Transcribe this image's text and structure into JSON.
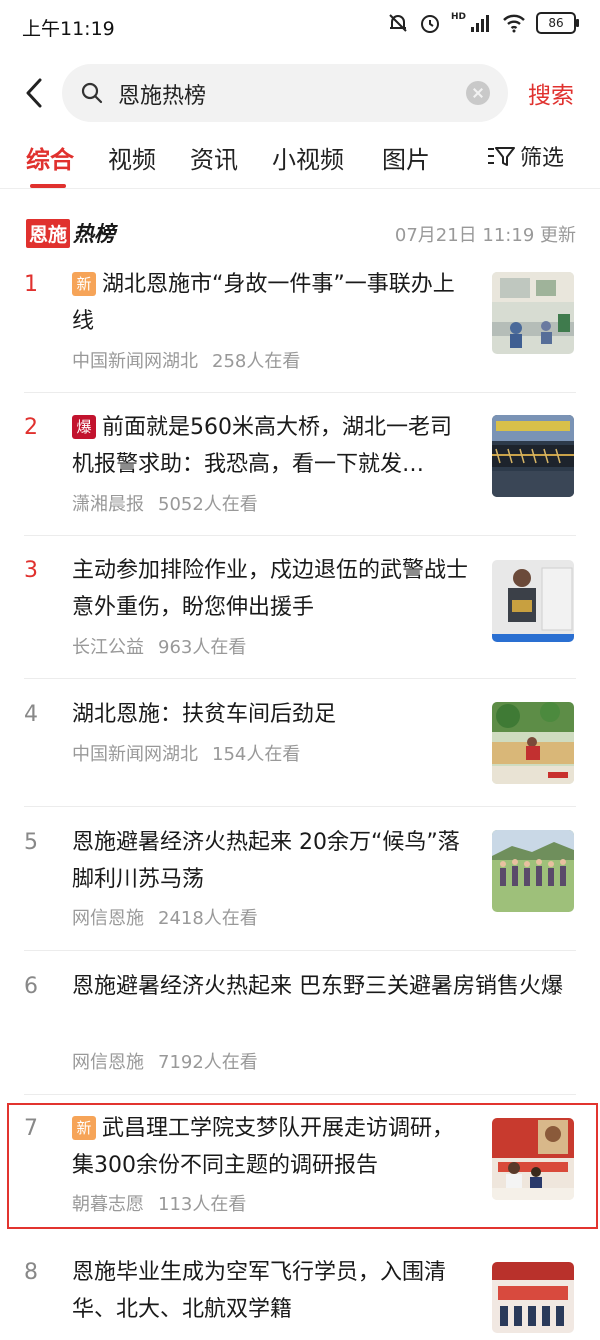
{
  "status": {
    "time": "上午11:19",
    "battery": "86",
    "net": "HD",
    "icons": [
      "mute-bell-icon",
      "alarm-icon",
      "signal-icon",
      "wifi-icon",
      "battery-icon"
    ]
  },
  "search": {
    "query": "恩施热榜",
    "button": "搜索",
    "icons": [
      "back-icon",
      "search-icon",
      "clear-icon"
    ]
  },
  "tabs": [
    "综合",
    "视频",
    "资讯",
    "小视频",
    "图片"
  ],
  "filter": {
    "label": "筛选",
    "icon": "filter-icon"
  },
  "hotlist": {
    "brand_a": "恩施",
    "brand_b": "热榜",
    "update_time": "07月21日  11:19  更新"
  },
  "colors": {
    "accent": "#e0312e",
    "tag_new": "#f6a458",
    "tag_hot": "#c2132e",
    "meta": "#999999"
  },
  "items": [
    {
      "rank": "1",
      "tag": "新",
      "title": "湖北恩施市“身故一件事”一事联办上线",
      "source": "中国新闻网湖北",
      "views": "258人在看"
    },
    {
      "rank": "2",
      "tag": "爆",
      "title": "前面就是560米高大桥，湖北一老司机报警求助：我恐高，看一下就发…",
      "source": "潇湘晨报",
      "views": "5052人在看"
    },
    {
      "rank": "3",
      "tag": "",
      "title": "主动参加排险作业，戍边退伍的武警战士意外重伤，盼您伸出援手",
      "source": "长江公益",
      "views": "963人在看"
    },
    {
      "rank": "4",
      "tag": "",
      "title": "湖北恩施：扶贫车间后劲足",
      "source": "中国新闻网湖北",
      "views": "154人在看"
    },
    {
      "rank": "5",
      "tag": "",
      "title": "恩施避暑经济火热起来 20余万“候鸟”落脚利川苏马荡",
      "source": "网信恩施",
      "views": "2418人在看"
    },
    {
      "rank": "6",
      "tag": "",
      "title": "恩施避暑经济火热起来 巴东野三关避暑房销售火爆",
      "source": "网信恩施",
      "views": "7192人在看"
    },
    {
      "rank": "7",
      "tag": "新",
      "title": "武昌理工学院支梦队开展走访调研，集300余份不同主题的调研报告",
      "source": "朝暮志愿",
      "views": "113人在看"
    },
    {
      "rank": "8",
      "tag": "",
      "title": "恩施毕业生成为空军飞行学员，入围清华、北大、北航双学籍",
      "source": "",
      "views": ""
    }
  ]
}
